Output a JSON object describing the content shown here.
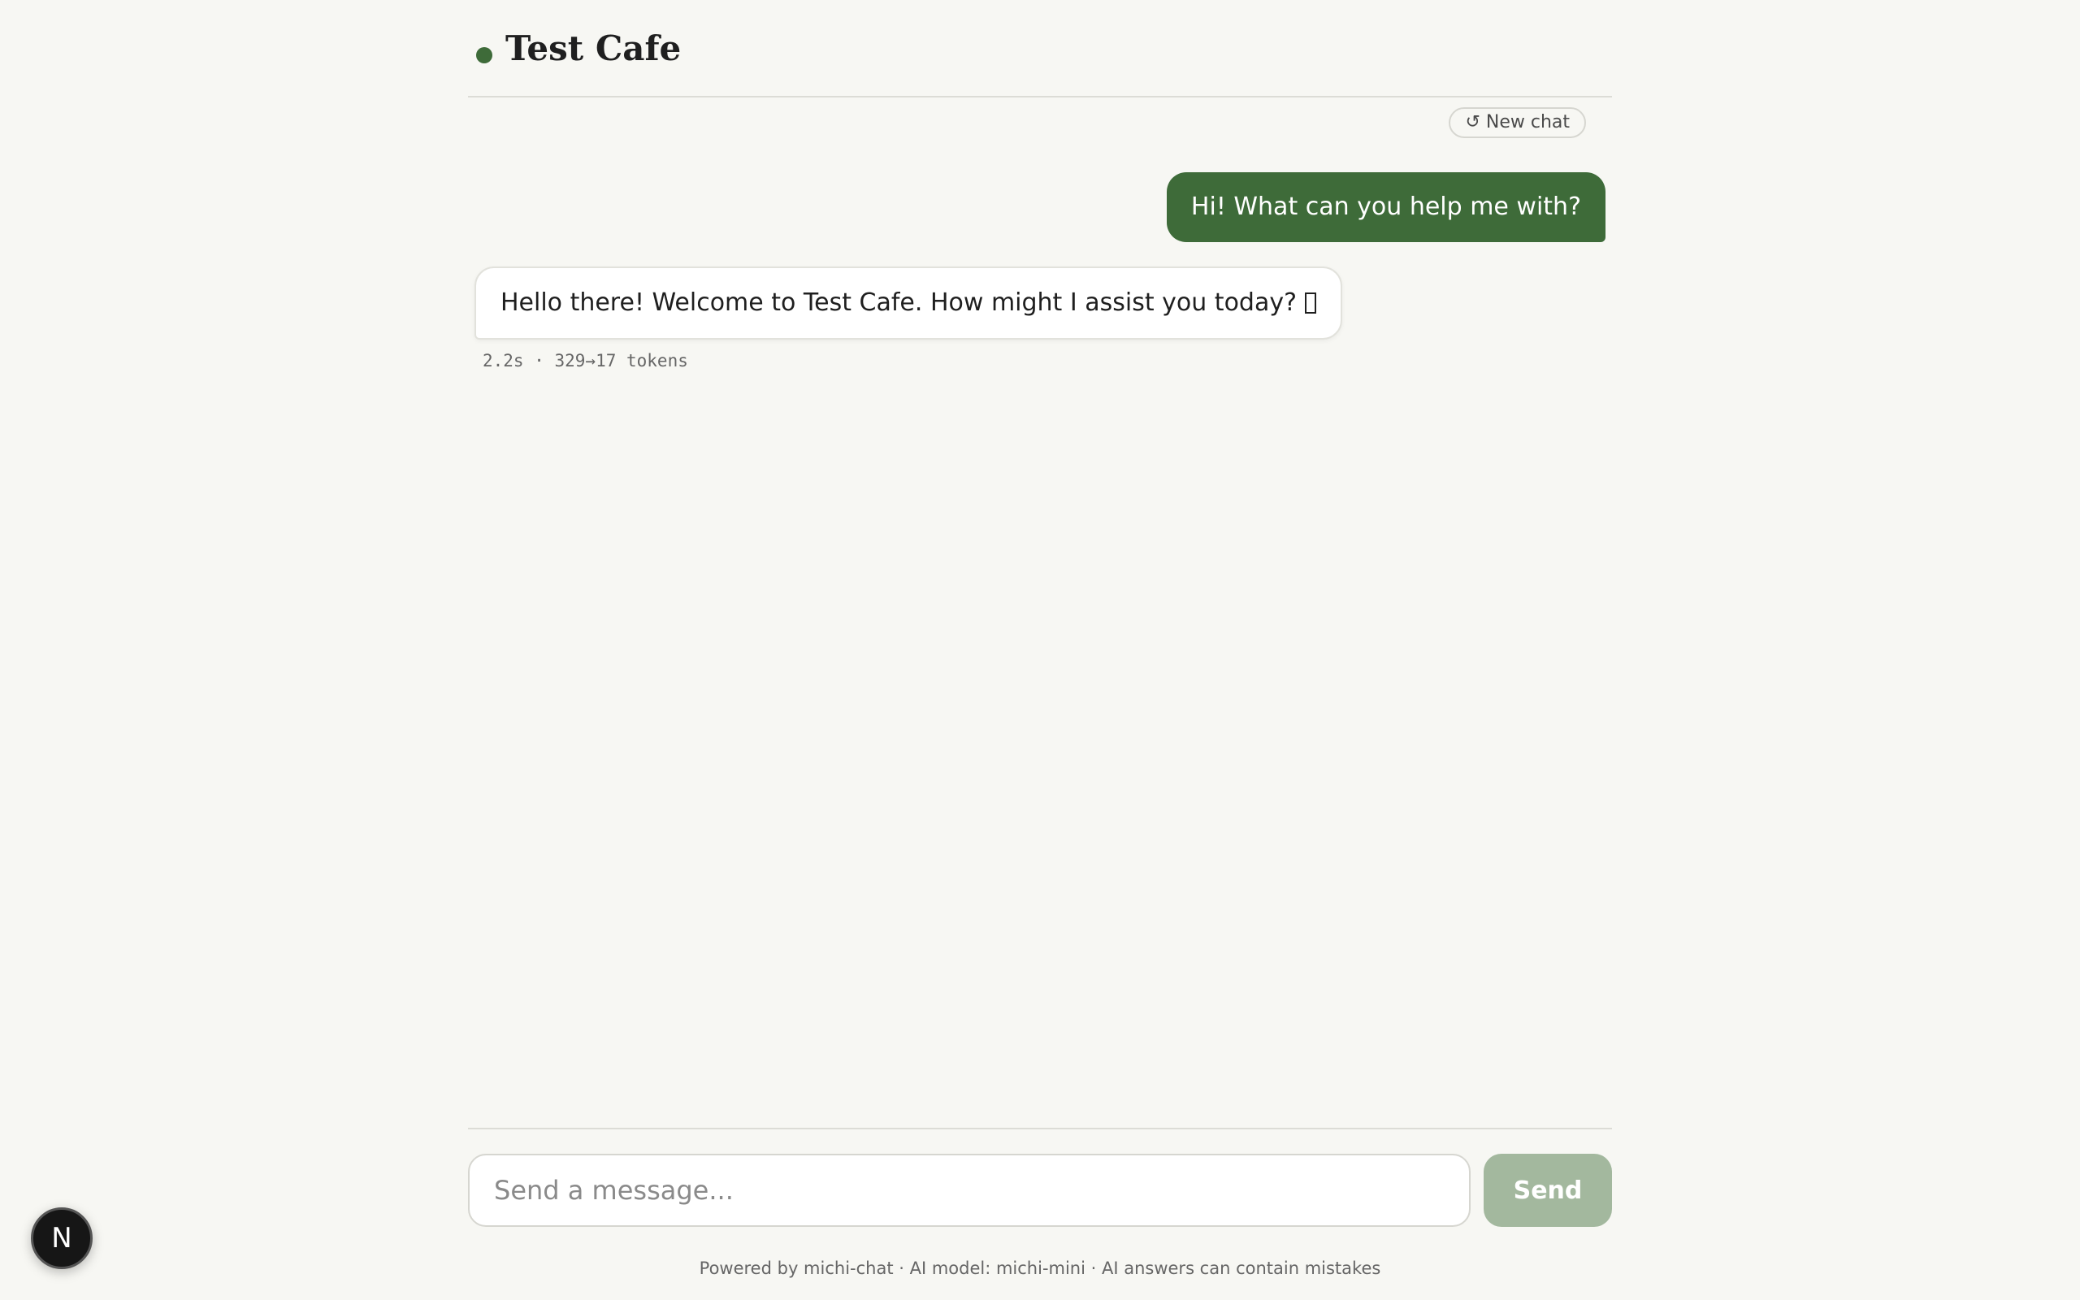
{
  "header": {
    "title": "Test Cafe",
    "status_color": "#3e6b39"
  },
  "toolbar": {
    "new_chat_label": "↺ New chat"
  },
  "messages": [
    {
      "role": "user",
      "text": "Hi! What can you help me with?"
    },
    {
      "role": "assistant",
      "text": "Hello there! Welcome to Test Cafe. How might I assist you today?",
      "trailing_icon": "missing-glyph-icon",
      "meta": "2.2s · 329→17 tokens"
    }
  ],
  "composer": {
    "placeholder": "Send a message...",
    "value": "",
    "send_label": "Send"
  },
  "footer": {
    "text": "Powered by michi-chat · AI model: michi-mini · AI answers can contain mistakes"
  },
  "badge": {
    "letter": "N",
    "icon": "nextjs-icon"
  },
  "colors": {
    "accent": "#3e6b39",
    "send_disabled": "#a3b89e",
    "background": "#f7f7f3"
  }
}
